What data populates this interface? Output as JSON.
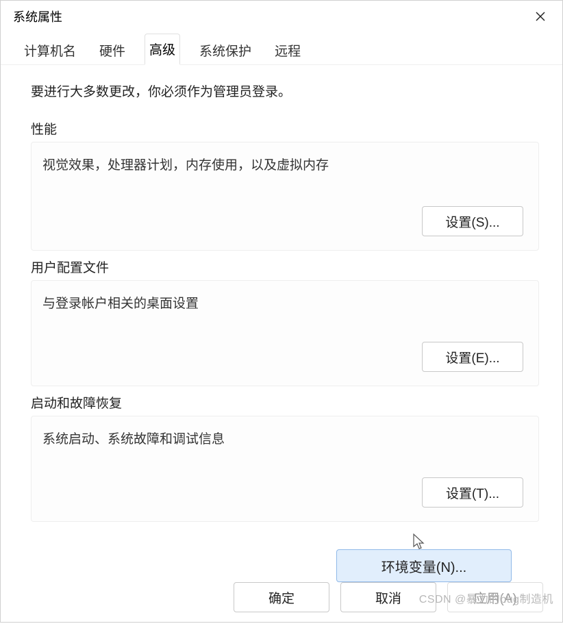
{
  "titlebar": {
    "title": "系统属性"
  },
  "tabs": {
    "computer_name": "计算机名",
    "hardware": "硬件",
    "advanced": "高级",
    "system_protection": "系统保护",
    "remote": "远程"
  },
  "content": {
    "info": "要进行大多数更改，你必须作为管理员登录。",
    "performance": {
      "title": "性能",
      "desc": "视觉效果，处理器计划，内存使用，以及虚拟内存",
      "button": "设置(S)..."
    },
    "user_profiles": {
      "title": "用户配置文件",
      "desc": "与登录帐户相关的桌面设置",
      "button": "设置(E)..."
    },
    "startup_recovery": {
      "title": "启动和故障恢复",
      "desc": "系统启动、系统故障和调试信息",
      "button": "设置(T)..."
    },
    "env_vars_button": "环境变量(N)..."
  },
  "footer": {
    "ok": "确定",
    "cancel": "取消",
    "apply": "应用(A)"
  },
  "watermark": "CSDN @暴力的bug制造机"
}
